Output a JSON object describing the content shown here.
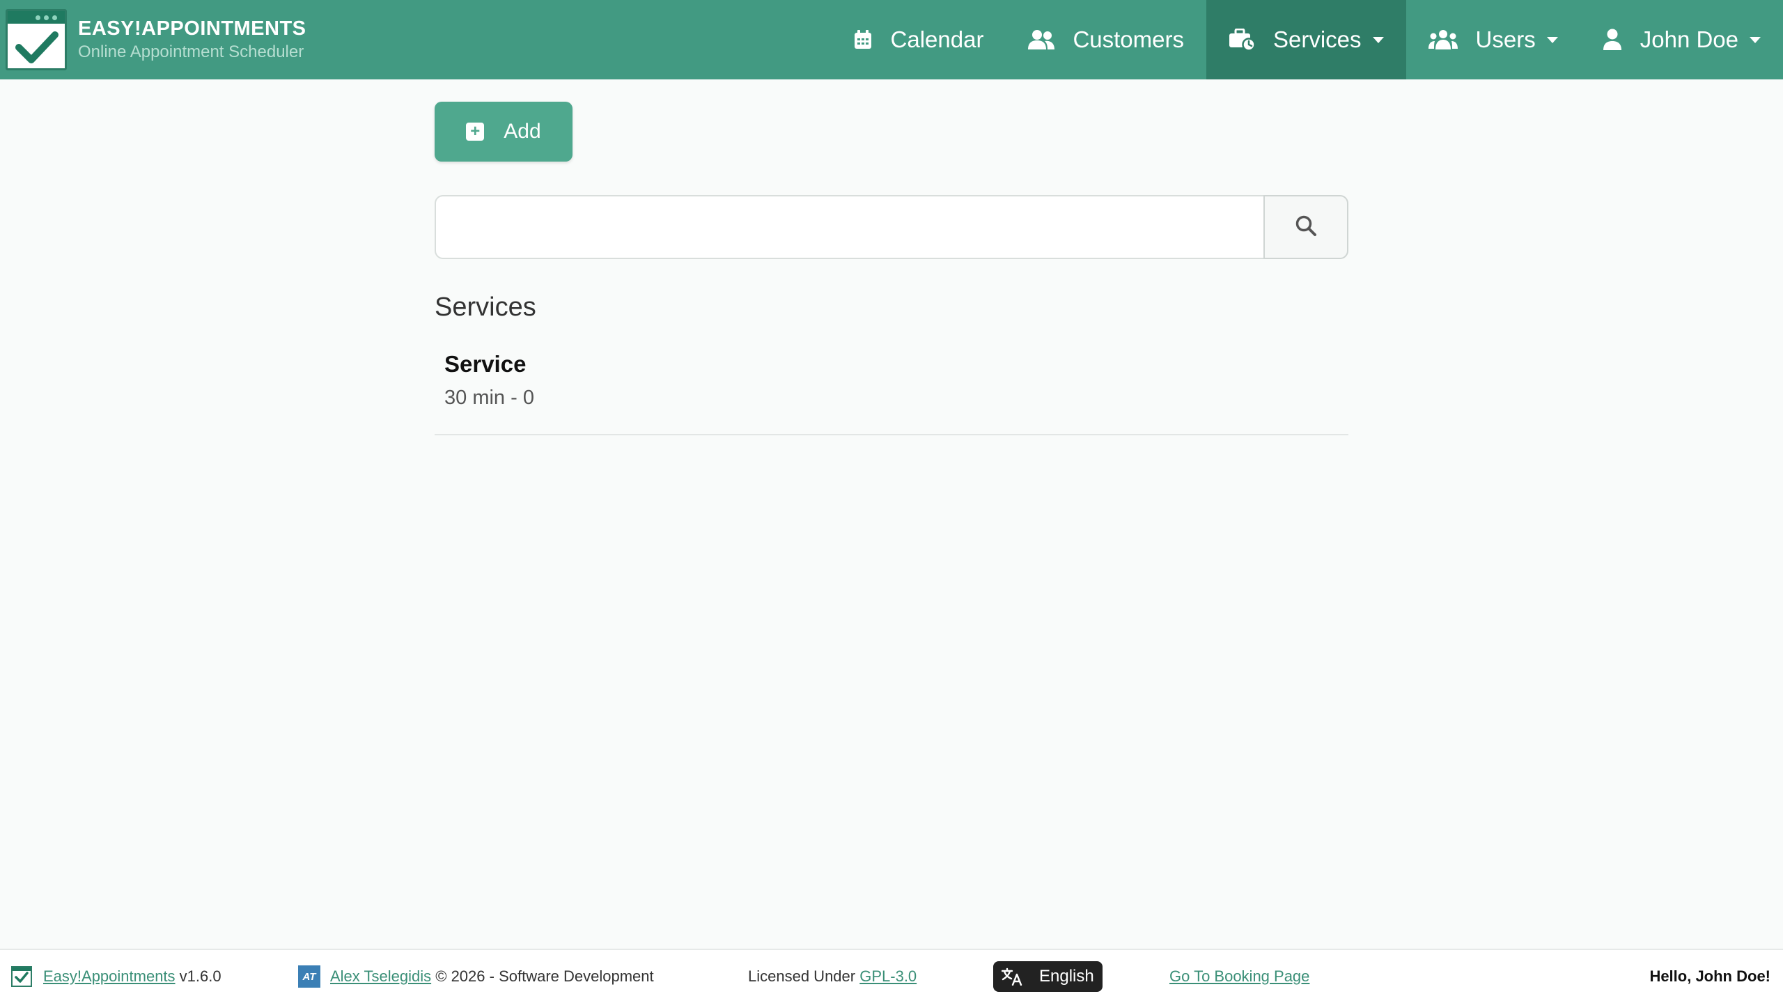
{
  "header": {
    "brand_title": "EASY!APPOINTMENTS",
    "brand_subtitle": "Online Appointment Scheduler",
    "colors": {
      "bar": "#429a82",
      "active": "#2f7d67"
    },
    "nav": [
      {
        "label": "Calendar",
        "icon": "calendar-icon",
        "dropdown": false,
        "active": false
      },
      {
        "label": "Customers",
        "icon": "customers-icon",
        "dropdown": false,
        "active": false
      },
      {
        "label": "Services",
        "icon": "services-icon",
        "dropdown": true,
        "active": true
      },
      {
        "label": "Users",
        "icon": "users-icon",
        "dropdown": true,
        "active": false
      },
      {
        "label": "John Doe",
        "icon": "user-icon",
        "dropdown": true,
        "active": false
      }
    ]
  },
  "main": {
    "add_label": "Add",
    "search": {
      "value": "",
      "placeholder": ""
    },
    "section_title": "Services",
    "items": [
      {
        "name": "Service",
        "info": "30 min - 0"
      }
    ]
  },
  "footer": {
    "app_link": "Easy!Appointments",
    "version": "v1.6.0",
    "author_link": "Alex Tselegidis",
    "copyright": "© 2026 - Software Development",
    "license_prefix": "Licensed Under",
    "license_link": "GPL-3.0",
    "language": "English",
    "booking_link": "Go To Booking Page",
    "greeting": "Hello, John Doe!"
  }
}
